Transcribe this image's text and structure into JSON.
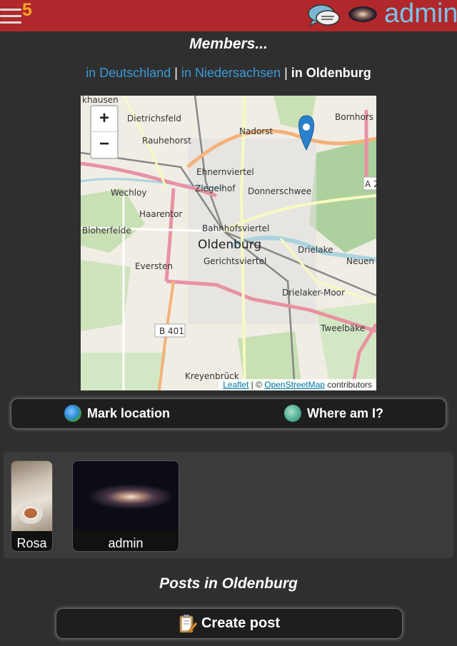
{
  "header": {
    "notification_count": "5",
    "username": "admin",
    "menu_icon": "hamburger-menu-icon",
    "chat_icon": "chat-bubbles-icon"
  },
  "page": {
    "title": "Members...",
    "breadcrumb": {
      "country": "in Deutschland",
      "state": "in Niedersachsen",
      "separator": "|",
      "city": "in Oldenburg"
    }
  },
  "map": {
    "zoom_in": "+",
    "zoom_out": "−",
    "attribution_leaflet": "Leaflet",
    "attribution_sep": " | © ",
    "attribution_osm": "OpenStreetMap",
    "attribution_tail": " contributors",
    "city_label": "Oldenburg",
    "places": [
      "khausen",
      "Dietrichsfeld",
      "Bornhors",
      "Nadorst",
      "Rauhehorst",
      "Ehnernviertel",
      "Ziegelhof",
      "Donnerschwee",
      "Wechloy",
      "Haarentor",
      "Bloherfelde",
      "Bahnhofsviertel",
      "Drielake",
      "Neuen",
      "Eversten",
      "Gerichtsviertel",
      "Drielaker-Moor",
      "Tweelbäke",
      "Kreyenbrück",
      "B 401",
      "A 2"
    ]
  },
  "actions": {
    "mark_location": "Mark location",
    "where_am_i": "Where am I?"
  },
  "members": [
    {
      "name": "Rosa"
    },
    {
      "name": "admin"
    }
  ],
  "posts": {
    "title": "Posts in Oldenburg",
    "create_label": "Create post"
  },
  "colors": {
    "topbar": "#b0282b",
    "accent_link": "#3a9ad9",
    "badge": "#f5a623",
    "username": "#7ac3e6"
  }
}
